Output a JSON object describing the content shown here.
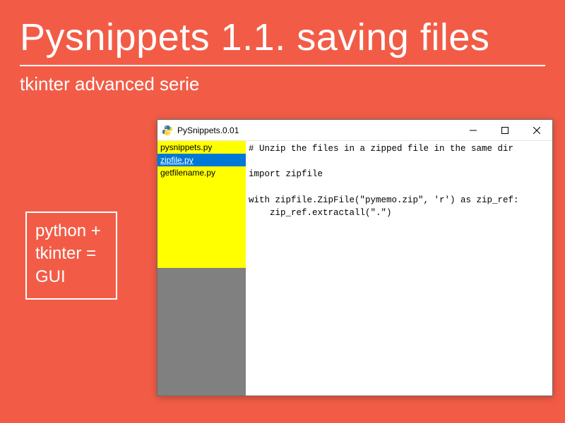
{
  "header": {
    "title": "Pysnippets 1.1. saving files",
    "subtitle": "tkinter advanced serie"
  },
  "sidebox": {
    "line1": "python +",
    "line2": "tkinter =",
    "line3": "GUI"
  },
  "window": {
    "title": "PySnippets.0.01",
    "files": [
      {
        "name": "pysnippets.py",
        "selected": false
      },
      {
        "name": "zipfile.py",
        "selected": true
      },
      {
        "name": "getfilename.py",
        "selected": false
      }
    ],
    "code_lines": [
      "# Unzip the files in a zipped file in the same dir",
      "",
      "import zipfile",
      "",
      "with zipfile.ZipFile(\"pymemo.zip\", 'r') as zip_ref:",
      "    zip_ref.extractall(\".\")"
    ]
  }
}
